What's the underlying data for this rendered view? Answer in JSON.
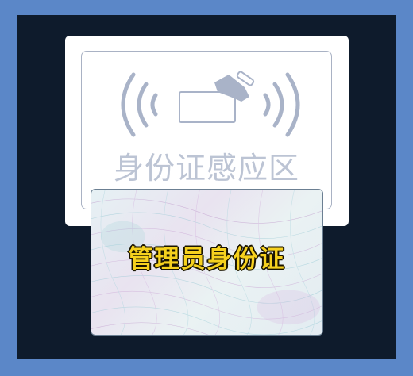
{
  "reader": {
    "label": "身份证感应区",
    "icon": "nfc-card-tap-icon"
  },
  "card": {
    "label": "管理员身份证"
  },
  "colors": {
    "outer_border": "#5b87c8",
    "frame_bg": "#0e1b2c",
    "icon_stroke": "#a9b3c8",
    "card_text": "#f6d11e"
  }
}
